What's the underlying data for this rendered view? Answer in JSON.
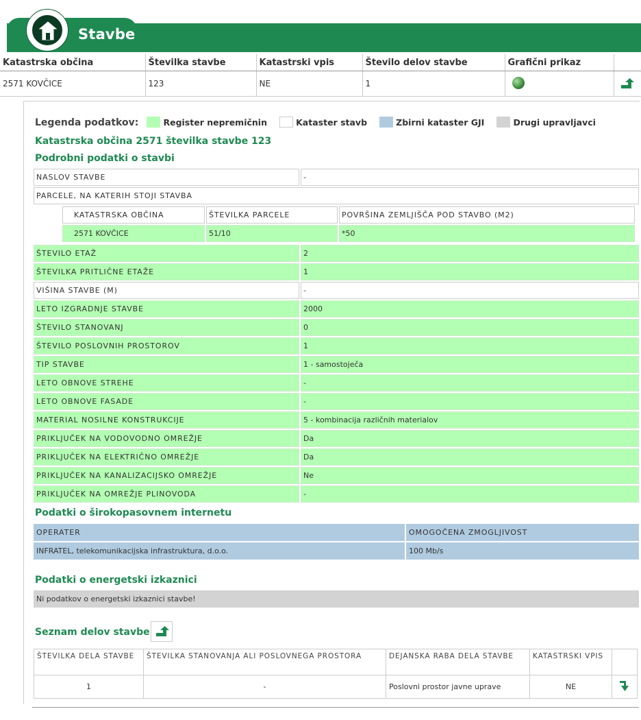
{
  "header": {
    "title": "Stavbe",
    "icon": "house-icon",
    "color": "#1e8a52"
  },
  "top_table": {
    "headers": [
      "Katastrska občina",
      "Številka stavbe",
      "Katastrski vpis",
      "Število delov stavbe",
      "Grafični prikaz"
    ],
    "row": [
      "2571 KOVČICE",
      "123",
      "NE",
      "1"
    ]
  },
  "legend": {
    "label": "Legenda podatkov:",
    "items": [
      {
        "text": "Register nepremičnin",
        "color": "#b3ffb3"
      },
      {
        "text": "Kataster stavb",
        "color": "#ffffff"
      },
      {
        "text": "Zbirni kataster GJI",
        "color": "#b0cbe0"
      },
      {
        "text": "Drugi upravljavci",
        "color": "#d3d3d3"
      }
    ]
  },
  "building_title": "Katastrska občina 2571  številka stavbe 123",
  "details_title": "Podrobni podatki o stavbi",
  "address": {
    "label": "NASLOV STAVBE",
    "value": "-"
  },
  "parcels": {
    "label": "PARCELE, NA KATERIH STOJI STAVBA",
    "headers": [
      "KATASTRSKA OBČINA",
      "ŠTEVILKA PARCELE",
      "POVRŠINA ZEMLJIŠČA POD STAVBO (M2)"
    ],
    "row": [
      "2571 KOVČICE",
      "51/10",
      "*50"
    ]
  },
  "details": [
    {
      "label": "ŠTEVILO ETAŽ",
      "value": "2"
    },
    {
      "label": "ŠTEVILKA PRITLIČNE ETAŽE",
      "value": "1"
    },
    {
      "label": "VIŠINA STAVBE (M)",
      "value": "-"
    },
    {
      "label": "LETO IZGRADNJE STAVBE",
      "value": "2000"
    },
    {
      "label": "ŠTEVILO STANOVANJ",
      "value": "0"
    },
    {
      "label": "ŠTEVILO POSLOVNIH PROSTOROV",
      "value": "1"
    },
    {
      "label": "TIP STAVBE",
      "value": "1 - samostoječa"
    },
    {
      "label": "LETO OBNOVE STREHE",
      "value": "-"
    },
    {
      "label": "LETO OBNOVE FASADE",
      "value": "-"
    },
    {
      "label": "MATERIAL NOSILNE KONSTRUKCIJE",
      "value": "5 - kombinacija različnih materialov"
    },
    {
      "label": "PRIKLJUČEK NA VODOVODNO OMREŽJE",
      "value": "Da"
    },
    {
      "label": "PRIKLJUČEK NA ELEKTRIČNO OMREŽJE",
      "value": "Da"
    },
    {
      "label": "PRIKLJUČEK NA KANALIZACIJSKO OMREŽJE",
      "value": "Ne"
    },
    {
      "label": "PRIKLJUČEK NA OMREŽJE PLINOVODA",
      "value": "-"
    }
  ],
  "broadband": {
    "title": "Podatki o širokopasovnem internetu",
    "headers": [
      "OPERATER",
      "OMOGOČENA ZMOGLJIVOST"
    ],
    "row": [
      "INFRATEL, telekomunikacijska infrastruktura, d.o.o.",
      "100 Mb/s"
    ]
  },
  "energy": {
    "title": "Podatki o energetski izkaznici",
    "message": "Ni podatkov o energetski izkaznici stavbe!"
  },
  "parts": {
    "title": "Seznam delov stavbe",
    "headers": [
      "ŠTEVILKA DELA STAVBE",
      "ŠTEVILKA STANOVANJA ALI POSLOVNEGA PROSTORA",
      "DEJANSKA RABA DELA STAVBE",
      "KATASTRSKI VPIS"
    ],
    "row": [
      "1",
      "-",
      "Poslovni prostor javne uprave",
      "NE"
    ]
  }
}
